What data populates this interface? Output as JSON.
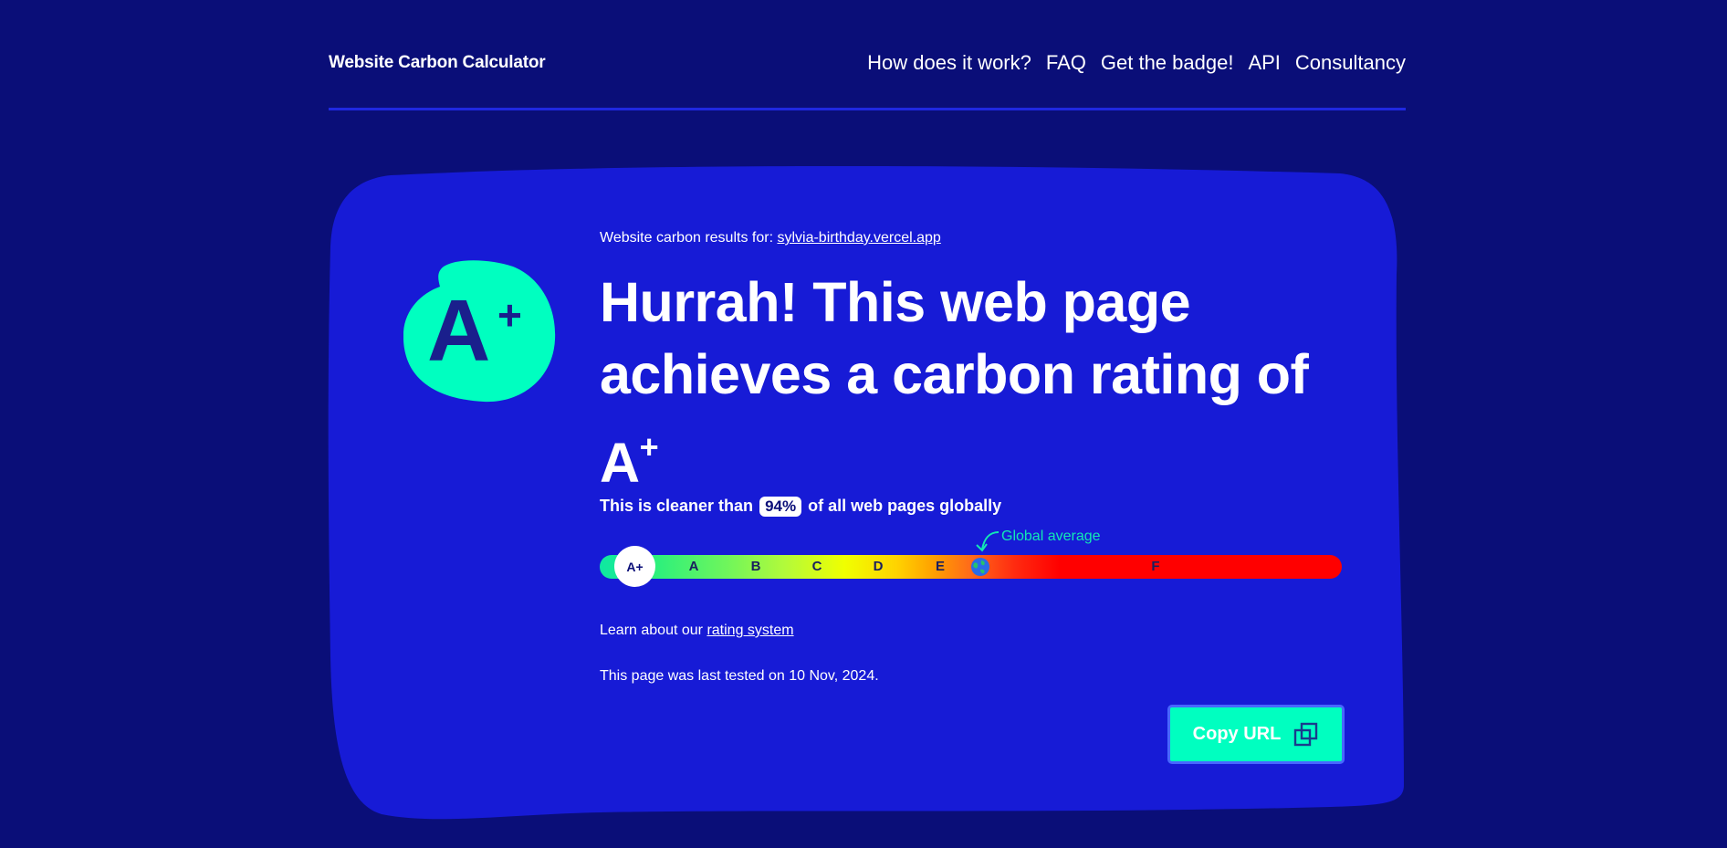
{
  "header": {
    "title": "Website Carbon Calculator",
    "nav": [
      {
        "label": "How does it work?"
      },
      {
        "label": "FAQ"
      },
      {
        "label": "Get the badge!"
      },
      {
        "label": "API"
      },
      {
        "label": "Consultancy"
      }
    ]
  },
  "results": {
    "for_label": "Website carbon results for:",
    "url": "sylvia-birthday.vercel.app",
    "headline": "Hurrah! This web page achieves a carbon rating of A",
    "headline_sup": "+",
    "badge_letter": "A",
    "badge_plus": "+",
    "cleaner_prefix": "This is cleaner than",
    "cleaner_pct": "94%",
    "cleaner_suffix": "of all web pages globally",
    "rating_marker": "A+",
    "grades": [
      "A",
      "B",
      "C",
      "D",
      "E",
      "F"
    ],
    "global_average_label": "Global average",
    "learn_prefix": "Learn about our",
    "learn_link": "rating system",
    "last_tested": "This page was last tested on 10 Nov, 2024.",
    "copy_button": "Copy URL"
  },
  "colors": {
    "background": "#0a0e78",
    "card": "#171bd6",
    "accent": "#00ffc0"
  },
  "icons": {
    "copy": "copy-icon",
    "globe": "globe-icon",
    "arrow": "curved-arrow-icon"
  }
}
